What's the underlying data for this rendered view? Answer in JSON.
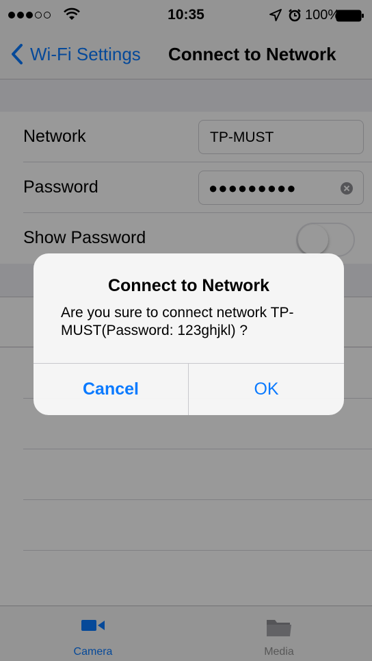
{
  "status_bar": {
    "time": "10:35",
    "battery_percent": "100%",
    "signal_bars_filled": 3,
    "signal_bars_total": 5
  },
  "nav": {
    "back_label": "Wi-Fi Settings",
    "title": "Connect to Network"
  },
  "form": {
    "network_label": "Network",
    "network_value": "TP-MUST",
    "password_label": "Password",
    "password_masked": "●●●●●●●●●",
    "show_password_label": "Show Password",
    "show_password_on": false
  },
  "alert": {
    "title": "Connect to Network",
    "message": "Are you sure to connect network TP-MUST(Password: 123ghjkl) ?",
    "cancel_label": "Cancel",
    "ok_label": "OK"
  },
  "tabs": [
    {
      "label": "Camera",
      "icon": "video-camera-icon",
      "active": true
    },
    {
      "label": "Media",
      "icon": "folder-icon",
      "active": false
    }
  ],
  "colors": {
    "accent": "#0a7aff",
    "inactive_tab": "#929292",
    "background": "#efeff4"
  }
}
